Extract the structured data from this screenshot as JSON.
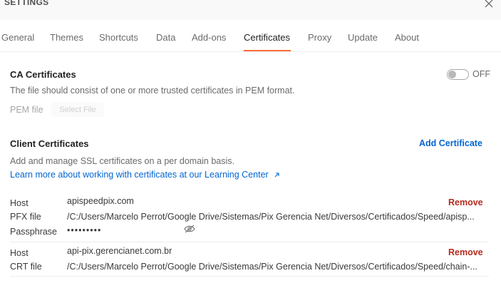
{
  "header": {
    "title": "SETTINGS",
    "close_icon": "close-icon"
  },
  "tabs": [
    {
      "label": "General"
    },
    {
      "label": "Themes"
    },
    {
      "label": "Shortcuts"
    },
    {
      "label": "Data"
    },
    {
      "label": "Add-ons"
    },
    {
      "label": "Certificates",
      "active": true
    },
    {
      "label": "Proxy"
    },
    {
      "label": "Update"
    },
    {
      "label": "About"
    }
  ],
  "ca": {
    "heading": "CA Certificates",
    "toggle_state": "OFF",
    "description": "The file should consist of one or more trusted certificates in PEM format.",
    "pem_label": "PEM file",
    "select_file_label": "Select File"
  },
  "client": {
    "heading": "Client Certificates",
    "add_label": "Add Certificate",
    "description": "Add and manage SSL certificates on a per domain basis.",
    "learn_more": "Learn more about working with certificates at our Learning Center",
    "certs": [
      {
        "host_label": "Host",
        "host": "apispeedpix.com",
        "file_label": "PFX file",
        "file": "/C:/Users/Marcelo Perrot/Google Drive/Sistemas/Pix Gerencia Net/Diversos/Certificados/Speed/apisp...",
        "passphrase_label": "Passphrase",
        "passphrase": "•••••••••",
        "remove_label": "Remove"
      },
      {
        "host_label": "Host",
        "host": "api-pix.gerencianet.com.br",
        "file_label": "CRT file",
        "file": "/C:/Users/Marcelo Perrot/Google Drive/Sistemas/Pix Gerencia Net/Diversos/Certificados/Speed/chain-...",
        "remove_label": "Remove"
      }
    ]
  },
  "colors": {
    "accent": "#ff6c37",
    "link": "#0265d2",
    "danger": "#b52b1d"
  }
}
